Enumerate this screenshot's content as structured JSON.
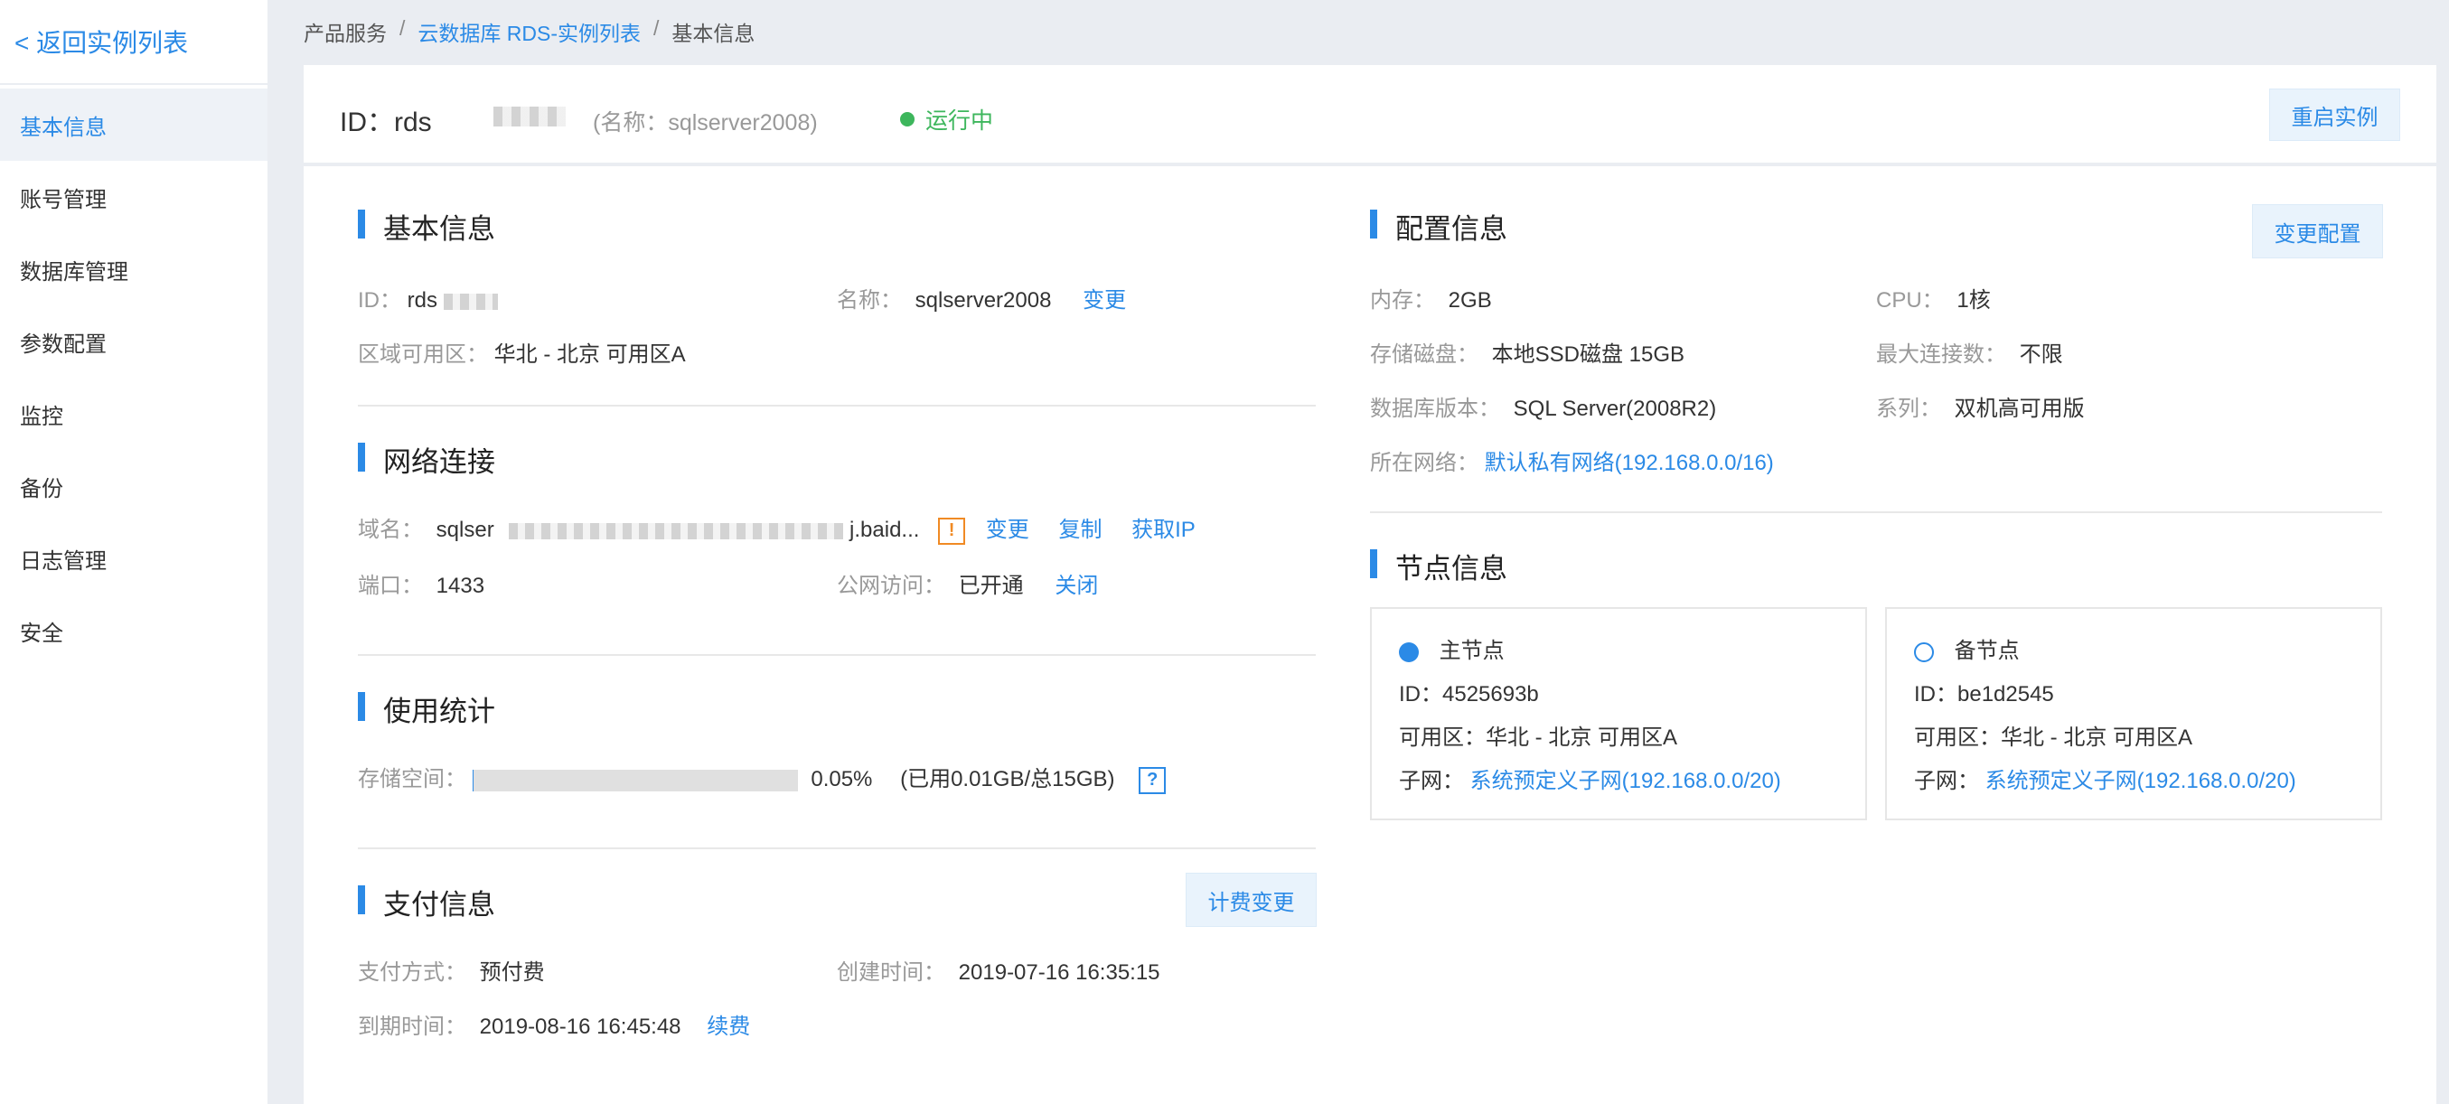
{
  "sidebar": {
    "back_label": "< 返回实例列表",
    "items": [
      {
        "label": "基本信息"
      },
      {
        "label": "账号管理"
      },
      {
        "label": "数据库管理"
      },
      {
        "label": "参数配置"
      },
      {
        "label": "监控"
      },
      {
        "label": "备份"
      },
      {
        "label": "日志管理"
      },
      {
        "label": "安全"
      }
    ]
  },
  "breadcrumb": {
    "items": [
      "产品服务",
      "云数据库 RDS-实例列表",
      "基本信息"
    ],
    "separator": "/"
  },
  "header": {
    "id_label": "ID：rds",
    "name_text": "(名称：sqlserver2008)",
    "status": "运行中",
    "status_color": "#3db65c",
    "restart_button": "重启实例"
  },
  "basic_info": {
    "title": "基本信息",
    "id_label": "ID：",
    "id_value": "rds",
    "name_label": "名称：",
    "name_value": "sqlserver2008",
    "name_action": "变更",
    "zone_label": "区域可用区：",
    "zone_value": "华北 - 北京 可用区A"
  },
  "network": {
    "title": "网络连接",
    "domain_label": "域名：",
    "domain_prefix": "sqlser",
    "domain_suffix": "j.baid...",
    "action_change": "变更",
    "action_copy": "复制",
    "action_get_ip": "获取IP",
    "port_label": "端口：",
    "port_value": "1433",
    "public_label": "公网访问：",
    "public_value": "已开通",
    "public_action": "关闭"
  },
  "usage": {
    "title": "使用统计",
    "storage_label": "存储空间：",
    "storage_percent": "0.05%",
    "storage_fraction": 0.0005,
    "storage_detail": "(已用0.01GB/总15GB)",
    "help_glyph": "?"
  },
  "payment": {
    "title": "支付信息",
    "billing_button": "计费变更",
    "method_label": "支付方式：",
    "method_value": "预付费",
    "created_label": "创建时间：",
    "created_value": "2019-07-16 16:35:15",
    "expire_label": "到期时间：",
    "expire_value": "2019-08-16 16:45:48",
    "renew_action": "续费"
  },
  "config": {
    "title": "配置信息",
    "change_button": "变更配置",
    "memory_label": "内存：",
    "memory_value": "2GB",
    "cpu_label": "CPU：",
    "cpu_value": "1核",
    "disk_label": "存储磁盘：",
    "disk_value": "本地SSD磁盘 15GB",
    "maxconn_label": "最大连接数：",
    "maxconn_value": "不限",
    "version_label": "数据库版本：",
    "version_value": "SQL Server(2008R2)",
    "series_label": "系列：",
    "series_value": "双机高可用版",
    "vpc_label": "所在网络：",
    "vpc_value": "默认私有网络(192.168.0.0/16)"
  },
  "nodes": {
    "title": "节点信息",
    "primary": {
      "label": "主节点",
      "id": "ID：4525693b",
      "zone": "可用区：华北 - 北京 可用区A",
      "subnet_label": "子网：",
      "subnet_value": "系统预定义子网(192.168.0.0/20)"
    },
    "standby": {
      "label": "备节点",
      "id": "ID：be1d2545",
      "zone": "可用区：华北 - 北京 可用区A",
      "subnet_label": "子网：",
      "subnet_value": "系统预定义子网(192.168.0.0/20)"
    }
  },
  "colors": {
    "accent": "#2b8ae6",
    "warning": "#f08a24",
    "success": "#3db65c"
  }
}
